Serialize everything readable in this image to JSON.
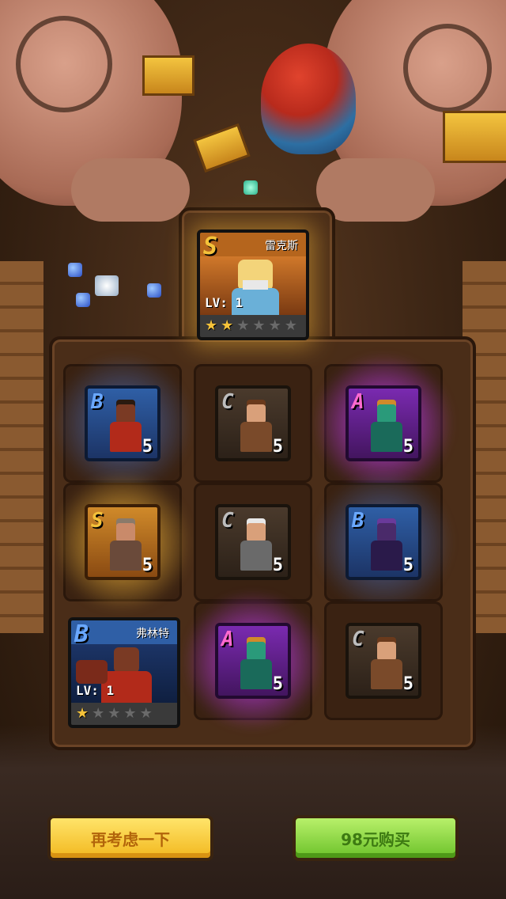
{
  "featured_card": {
    "name": "雷克斯",
    "rank": "S",
    "level_text": "LV: 1",
    "stars_on": 2,
    "stars_total": 6,
    "accent": "#d08a2a"
  },
  "grid": [
    {
      "rank": "B",
      "level": "5",
      "hair": "#2a1a10",
      "skin": "#7a3a24",
      "cloth": "#b22a1a"
    },
    {
      "rank": "C",
      "level": "5",
      "hair": "#6a3a1c",
      "skin": "#d9a07a",
      "cloth": "#7a4a2a"
    },
    {
      "rank": "A",
      "level": "5",
      "hair": "#d08a2a",
      "skin": "#2a9a7a",
      "cloth": "#1a6a5a"
    },
    {
      "rank": "S",
      "level": "5",
      "hair": "#8a7a6a",
      "skin": "#c98a6a",
      "cloth": "#6a4a3a"
    },
    {
      "rank": "C",
      "level": "5",
      "hair": "#e8e8e8",
      "skin": "#d9a07a",
      "cloth": "#6a6a6a"
    },
    {
      "rank": "B",
      "level": "5",
      "hair": "#6a3a9a",
      "skin": "#4a2a6a",
      "cloth": "#2a1a4a"
    },
    null,
    {
      "rank": "A",
      "level": "5",
      "hair": "#d08a2a",
      "skin": "#2a9a7a",
      "cloth": "#1a6a5a"
    },
    {
      "rank": "C",
      "level": "5",
      "hair": "#6a3a1c",
      "skin": "#d9a07a",
      "cloth": "#7a4a2a"
    }
  ],
  "bottom_card": {
    "name": "弗林特",
    "rank": "B",
    "level_text": "LV: 1",
    "stars_on": 1,
    "stars_total": 5,
    "accent": "#2f5fa6"
  },
  "buttons": {
    "reconsider": "再考虑一下",
    "buy": "98元购买"
  }
}
